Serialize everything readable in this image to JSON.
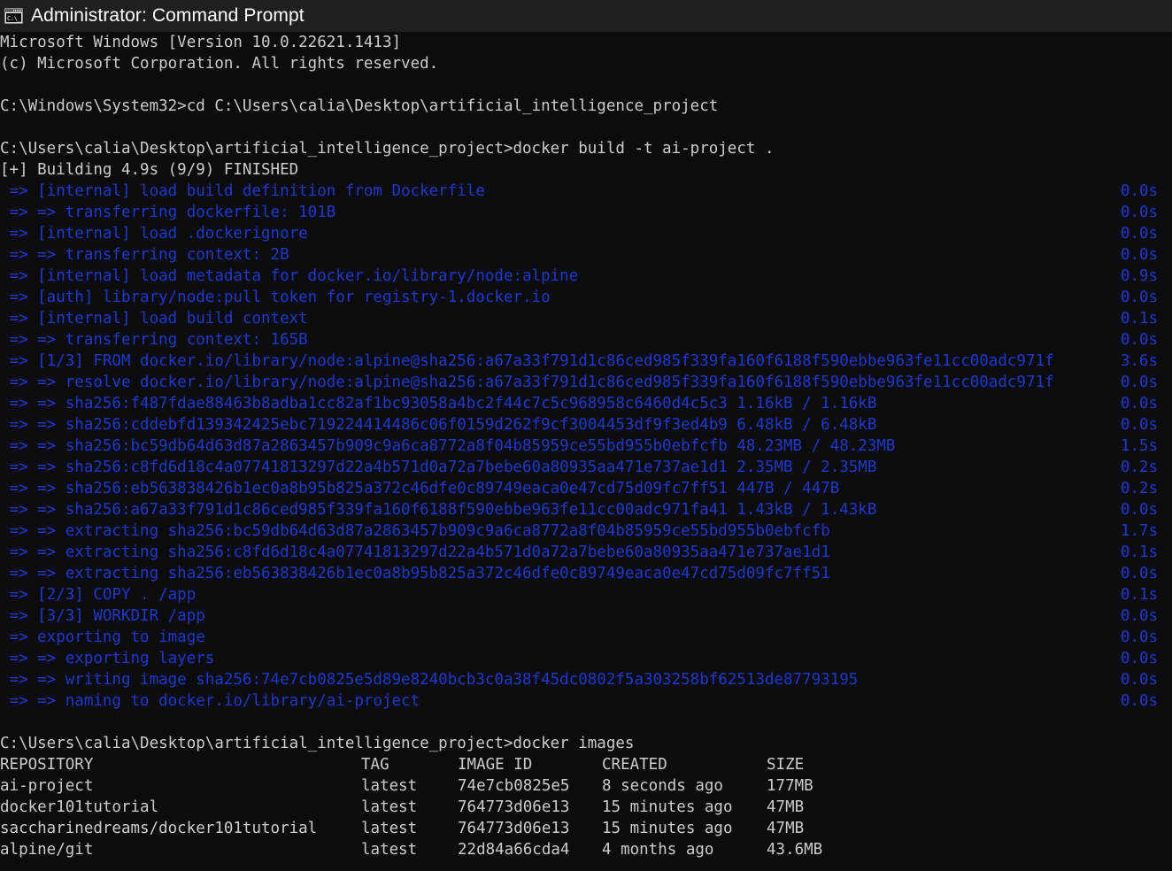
{
  "window": {
    "title": "Administrator: Command Prompt",
    "icon_name": "cmd-icon",
    "icon_glyph": "C:\\_",
    "titlebar_bg": "#1f1f1f",
    "console_bg": "#0c0c0c",
    "text_color": "#cccccc",
    "accent_blue": "#2039c4"
  },
  "console": {
    "header": [
      "Microsoft Windows [Version 10.0.22621.1413]",
      "(c) Microsoft Corporation. All rights reserved."
    ],
    "prompt_1": "C:\\Windows\\System32>",
    "command_1": "cd C:\\Users\\calia\\Desktop\\artificial_intelligence_project",
    "prompt_2": "C:\\Users\\calia\\Desktop\\artificial_intelligence_project>",
    "command_2": "docker build -t ai-project .",
    "build_status": "[+] Building 4.9s (9/9) FINISHED",
    "build_steps": [
      {
        "text": " => [internal] load build definition from Dockerfile",
        "time": "0.0s"
      },
      {
        "text": " => => transferring dockerfile: 101B",
        "time": "0.0s"
      },
      {
        "text": " => [internal] load .dockerignore",
        "time": "0.0s"
      },
      {
        "text": " => => transferring context: 2B",
        "time": "0.0s"
      },
      {
        "text": " => [internal] load metadata for docker.io/library/node:alpine",
        "time": "0.9s"
      },
      {
        "text": " => [auth] library/node:pull token for registry-1.docker.io",
        "time": "0.0s"
      },
      {
        "text": " => [internal] load build context",
        "time": "0.1s"
      },
      {
        "text": " => => transferring context: 165B",
        "time": "0.0s"
      },
      {
        "text": " => [1/3] FROM docker.io/library/node:alpine@sha256:a67a33f791d1c86ced985f339fa160f6188f590ebbe963fe11cc00adc971f",
        "time": "3.6s"
      },
      {
        "text": " => => resolve docker.io/library/node:alpine@sha256:a67a33f791d1c86ced985f339fa160f6188f590ebbe963fe11cc00adc971f",
        "time": "0.0s"
      },
      {
        "text": " => => sha256:f487fdae88463b8adba1cc82af1bc93058a4bc2f44c7c5c968958c6460d4c5c3 1.16kB / 1.16kB",
        "time": "0.0s"
      },
      {
        "text": " => => sha256:cddebfd139342425ebc719224414486c06f0159d262f9cf3004453df9f3ed4b9 6.48kB / 6.48kB",
        "time": "0.0s"
      },
      {
        "text": " => => sha256:bc59db64d63d87a2863457b909c9a6ca8772a8f04b85959ce55bd955b0ebfcfb 48.23MB / 48.23MB",
        "time": "1.5s"
      },
      {
        "text": " => => sha256:c8fd6d18c4a07741813297d22a4b571d0a72a7bebe60a80935aa471e737ae1d1 2.35MB / 2.35MB",
        "time": "0.2s"
      },
      {
        "text": " => => sha256:eb563838426b1ec0a8b95b825a372c46dfe0c89749eaca0e47cd75d09fc7ff51 447B / 447B",
        "time": "0.2s"
      },
      {
        "text": " => => sha256:a67a33f791d1c86ced985f339fa160f6188f590ebbe963fe11cc00adc971fa41 1.43kB / 1.43kB",
        "time": "0.0s"
      },
      {
        "text": " => => extracting sha256:bc59db64d63d87a2863457b909c9a6ca8772a8f04b85959ce55bd955b0ebfcfb",
        "time": "1.7s"
      },
      {
        "text": " => => extracting sha256:c8fd6d18c4a07741813297d22a4b571d0a72a7bebe60a80935aa471e737ae1d1",
        "time": "0.1s"
      },
      {
        "text": " => => extracting sha256:eb563838426b1ec0a8b95b825a372c46dfe0c89749eaca0e47cd75d09fc7ff51",
        "time": "0.0s"
      },
      {
        "text": " => [2/3] COPY . /app",
        "time": "0.1s"
      },
      {
        "text": " => [3/3] WORKDIR /app",
        "time": "0.0s"
      },
      {
        "text": " => exporting to image",
        "time": "0.0s"
      },
      {
        "text": " => => exporting layers",
        "time": "0.0s"
      },
      {
        "text": " => => writing image sha256:74e7cb0825e5d89e8240bcb3c0a38f45dc0802f5a303258bf62513de87793195",
        "time": "0.0s"
      },
      {
        "text": " => => naming to docker.io/library/ai-project",
        "time": "0.0s"
      }
    ],
    "prompt_3": "C:\\Users\\calia\\Desktop\\artificial_intelligence_project>",
    "command_3": "docker images"
  },
  "images_table": {
    "headers": [
      "REPOSITORY",
      "TAG",
      "IMAGE ID",
      "CREATED",
      "SIZE"
    ],
    "rows": [
      {
        "repository": "ai-project",
        "tag": "latest",
        "image_id": "74e7cb0825e5",
        "created": "8 seconds ago",
        "size": "177MB"
      },
      {
        "repository": "docker101tutorial",
        "tag": "latest",
        "image_id": "764773d06e13",
        "created": "15 minutes ago",
        "size": "47MB"
      },
      {
        "repository": "saccharinedreams/docker101tutorial",
        "tag": "latest",
        "image_id": "764773d06e13",
        "created": "15 minutes ago",
        "size": "47MB"
      },
      {
        "repository": "alpine/git",
        "tag": "latest",
        "image_id": "22d84a66cda4",
        "created": "4 months ago",
        "size": "43.6MB"
      }
    ]
  }
}
